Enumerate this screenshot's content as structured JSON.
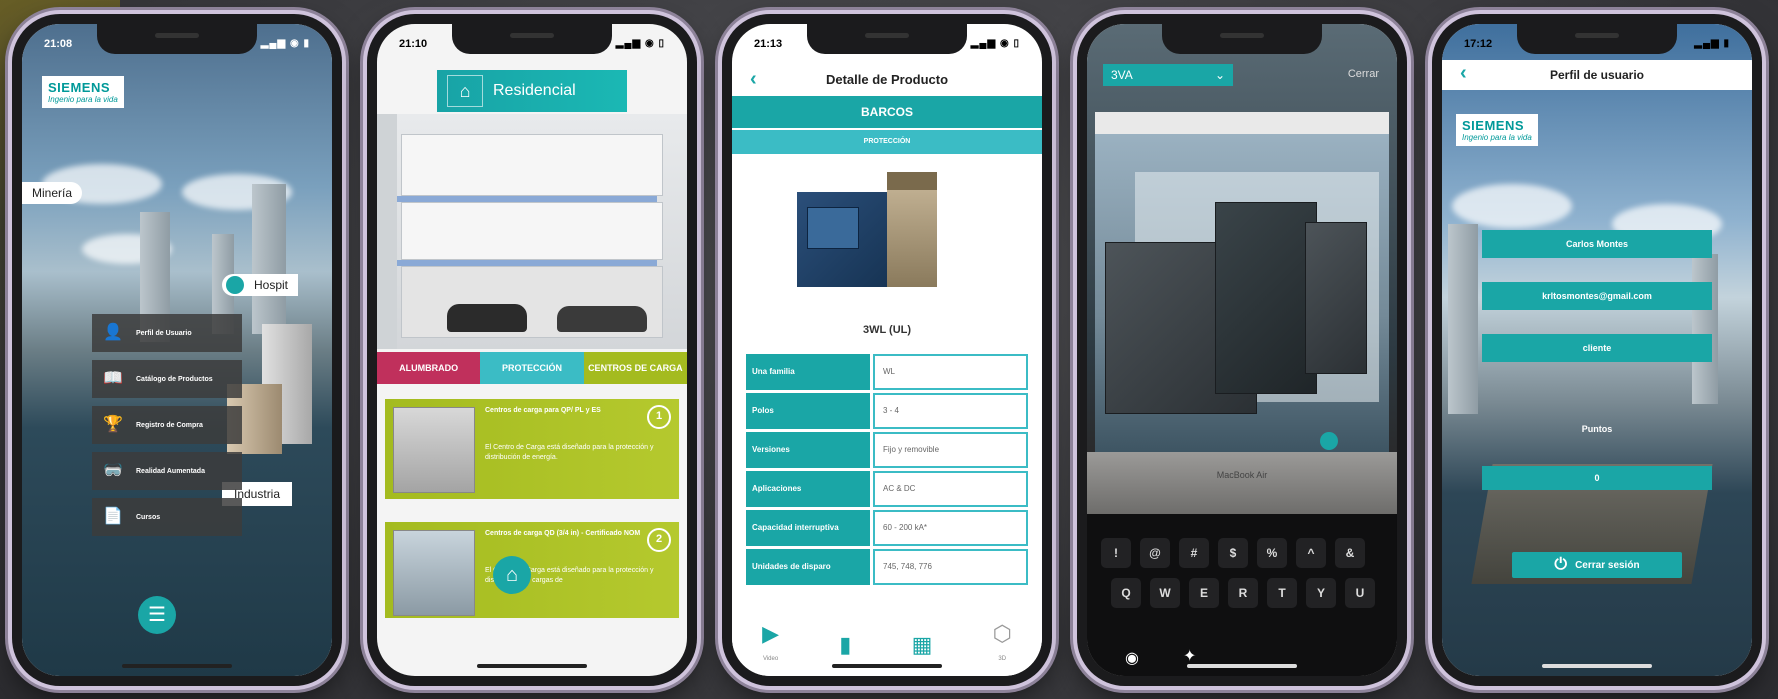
{
  "phone1": {
    "time": "21:08",
    "logo_main": "SIEMENS",
    "logo_sub": "Ingenio para la vida",
    "labels": {
      "mineria": "Minería",
      "hospital": "Hospit",
      "industria": "Industria"
    },
    "menu": [
      {
        "label": "Perfil de Usuario",
        "icon": "user-icon"
      },
      {
        "label": "Catálogo de Productos",
        "icon": "book-icon"
      },
      {
        "label": "Registro de Compra",
        "icon": "trophy-icon"
      },
      {
        "label": "Realidad Aumentada",
        "icon": "vr-headset-icon"
      },
      {
        "label": "Cursos",
        "icon": "document-icon"
      }
    ]
  },
  "phone2": {
    "time": "21:10",
    "header_title": "Residencial",
    "tabs": [
      {
        "label": "ALUMBRADO",
        "color": "#c0305c"
      },
      {
        "label": "PROTECCIÓN",
        "color": "#3bbcc5"
      },
      {
        "label": "CENTROS DE CARGA",
        "color": "#a4bb1f"
      }
    ],
    "products": [
      {
        "num": "1",
        "title": "Centros de carga para QP/ PL y ES",
        "desc": "El Centro de Carga está diseñado para la protección y distribución de energía."
      },
      {
        "num": "2",
        "title": "Centros de carga QD (3/4 in) - Certificado NOM",
        "desc": "El Centro de Carga está diseñado para la protección y distribución de cargas de"
      }
    ]
  },
  "phone3": {
    "time": "21:13",
    "title": "Detalle de Producto",
    "bar1": "BARCOS",
    "bar2": "PROTECCIÓN",
    "product_name": "3WL (UL)",
    "specs": [
      {
        "k": "Una familia",
        "v": "WL"
      },
      {
        "k": "Polos",
        "v": "3 - 4"
      },
      {
        "k": "Versiones",
        "v": "Fijo y removible"
      },
      {
        "k": "Aplicaciones",
        "v": "AC & DC"
      },
      {
        "k": "Capacidad interruptiva",
        "v": "60 - 200 kA*"
      },
      {
        "k": "Unidades de disparo",
        "v": "745, 748, 776"
      }
    ],
    "nav": [
      {
        "label": "Video",
        "icon": "play-icon"
      },
      {
        "label": "",
        "icon": "file-icon"
      },
      {
        "label": "",
        "icon": "map-book-icon"
      },
      {
        "label": "3D",
        "icon": "cube-icon"
      }
    ]
  },
  "phone4": {
    "select_value": "3VA",
    "close_label": "Cerrar",
    "laptop_brand": "MacBook Air",
    "keys_row1": [
      "!",
      "@",
      "#",
      "$",
      "%",
      "^",
      "&"
    ],
    "keys_row2": [
      "Q",
      "W",
      "E",
      "R",
      "T",
      "Y",
      "U"
    ]
  },
  "phone5": {
    "time": "17:12",
    "title": "Perfil de usuario",
    "logo_main": "SIEMENS",
    "logo_sub": "Ingenio para la vida",
    "name": "Carlos Montes",
    "email": "krltosmontes@gmail.com",
    "role": "cliente",
    "points_label": "Puntos",
    "points": "0",
    "logout": "Cerrar sesión"
  }
}
